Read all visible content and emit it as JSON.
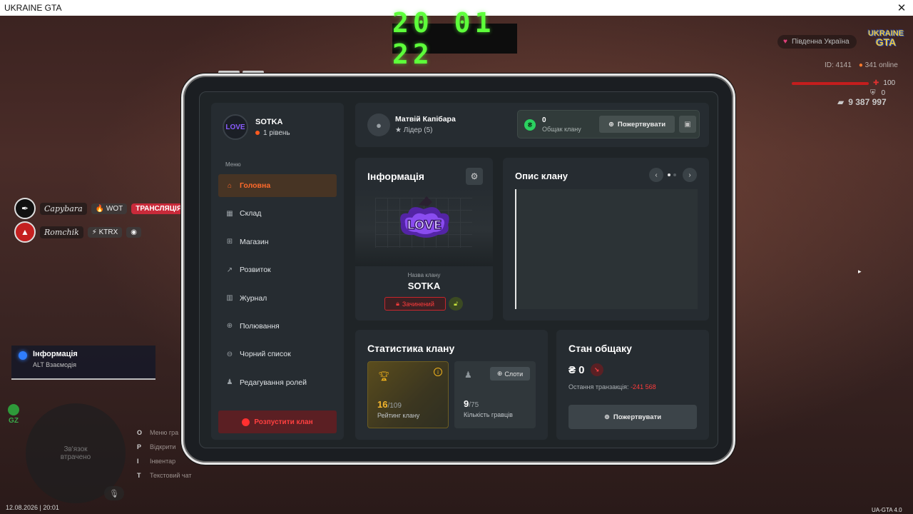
{
  "window": {
    "title": "UKRAINE GTA",
    "close_glyph": "✕"
  },
  "hud": {
    "clock": "20 01 22",
    "region": "Південна Україна",
    "logo_top": "UKRAINE",
    "logo_bottom": "GTA",
    "player_id": "ID: 4141",
    "online": "341 online",
    "health": "100",
    "armor": "0",
    "money": "9 387 997",
    "date": "12.08.2026 | 20:01",
    "version": "UA-GTA 4.0",
    "gz_label": "GZ",
    "minimap_text": "Зв'язок втрачено",
    "hotkeys": [
      {
        "key": "O",
        "label": "Меню гра"
      },
      {
        "key": "P",
        "label": "Відкрити"
      },
      {
        "key": "I",
        "label": "Інвентар"
      },
      {
        "key": "T",
        "label": "Текстовий чат"
      }
    ],
    "players": [
      {
        "name": "Capybara",
        "tag": "🔥 WOT",
        "stream": "ТРАНСЛЯЦІЯ"
      },
      {
        "name": "Romchik",
        "tag": "⚡ KTRX"
      }
    ],
    "toast": {
      "title": "Інформація",
      "subtitle": "ALT Взаємодія"
    }
  },
  "sidebar": {
    "clan_name": "SOTKA",
    "clan_level": "1 рівень",
    "menu_caption": "Меню",
    "items": [
      {
        "label": "Головна",
        "icon": "home-icon"
      },
      {
        "label": "Склад",
        "icon": "warehouse-icon"
      },
      {
        "label": "Магазин",
        "icon": "cart-icon"
      },
      {
        "label": "Розвиток",
        "icon": "chart-icon"
      },
      {
        "label": "Журнал",
        "icon": "book-icon"
      },
      {
        "label": "Полювання",
        "icon": "crosshair-icon"
      },
      {
        "label": "Чорний список",
        "icon": "block-icon"
      },
      {
        "label": "Редагування ролей",
        "icon": "user-edit-icon"
      }
    ],
    "disband_label": "Розпустити клан"
  },
  "topbar": {
    "user_name": "Матвій Капібара",
    "user_role": "Лідер (5)",
    "bank_value": "0",
    "bank_label": "Общак клану",
    "donate_label": "Пожертвувати"
  },
  "info_card": {
    "title": "Інформація",
    "logo_text": "LOVE",
    "clan_name_caption": "Назва клану",
    "clan_name": "SOTKA",
    "status_label": "Зачинений"
  },
  "desc_card": {
    "title": "Опис клану"
  },
  "stats_card": {
    "title": "Статистика клану",
    "rating_value": "16",
    "rating_total": "/109",
    "rating_label": "Рейтинг клану",
    "slots_label": "Слоти",
    "players_value": "9",
    "players_total": "/75",
    "players_label": "Кількість гравців"
  },
  "bank_card": {
    "title": "Стан общаку",
    "amount": "₴ 0",
    "last_tx_label": "Остання транзакція:",
    "last_tx_value": "-241 568",
    "donate_label": "Пожертвувати"
  },
  "colors": {
    "accent": "#ff6a2b",
    "danger": "#ff3b3b",
    "gold": "#f3b52e",
    "green": "#2bd160"
  }
}
